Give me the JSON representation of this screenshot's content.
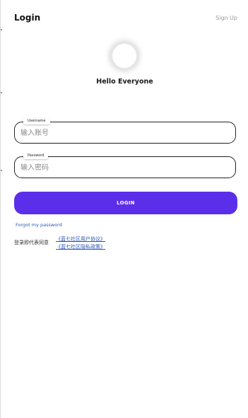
{
  "header": {
    "title": "Login",
    "signup_label": "Sign Up"
  },
  "profile": {
    "greeting": "Hello Everyone"
  },
  "form": {
    "username": {
      "label": "Username",
      "placeholder": "输入账号",
      "value": ""
    },
    "password": {
      "label": "Password",
      "placeholder": "输入密码",
      "value": ""
    },
    "login_label": "LOGIN",
    "forgot_label": "Forgot my password"
  },
  "agreement": {
    "prefix": "登录即代表同意",
    "user_agreement": "《蓝七社区用户协议》",
    "privacy_policy": "《蓝七社区隐私政策》"
  },
  "colors": {
    "accent": "#5b2eea",
    "link": "#2a55b8"
  }
}
